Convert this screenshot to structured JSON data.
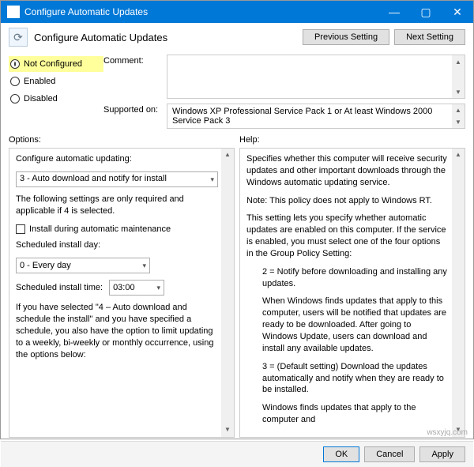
{
  "window": {
    "title": "Configure Automatic Updates"
  },
  "header": {
    "title": "Configure Automatic Updates",
    "btn_prev": "Previous Setting",
    "btn_next": "Next Setting"
  },
  "state": {
    "not_configured": "Not Configured",
    "enabled": "Enabled",
    "disabled": "Disabled",
    "selected": "not_configured"
  },
  "fields": {
    "comment_label": "Comment:",
    "comment_value": "",
    "supported_label": "Supported on:",
    "supported_value": "Windows XP Professional Service Pack 1 or At least Windows 2000 Service Pack 3"
  },
  "options": {
    "pane_label": "Options:",
    "update_label": "Configure automatic updating:",
    "update_value": "3 - Auto download and notify for install",
    "note": "The following settings are only required and applicable if 4 is selected.",
    "maint_check": "Install during automatic maintenance",
    "day_label": "Scheduled install day:",
    "day_value": "0 - Every day",
    "time_label": "Scheduled install time:",
    "time_value": "03:00",
    "tail": "If you have selected \"4 – Auto download and schedule the install\" and you have specified a schedule, you also have the option to limit updating to a weekly, bi-weekly or monthly occurrence, using the options below:"
  },
  "help": {
    "pane_label": "Help:",
    "p1": "Specifies whether this computer will receive security updates and other important downloads through the Windows automatic updating service.",
    "p2": "Note: This policy does not apply to Windows RT.",
    "p3": "This setting lets you specify whether automatic updates are enabled on this computer. If the service is enabled, you must select one of the four options in the Group Policy Setting:",
    "p4": "2 = Notify before downloading and installing any updates.",
    "p5": "When Windows finds updates that apply to this computer, users will be notified that updates are ready to be downloaded. After going to Windows Update, users can download and install any available updates.",
    "p6": "3 = (Default setting) Download the updates automatically and notify when they are ready to be installed.",
    "p7": "Windows finds updates that apply to the computer and"
  },
  "footer": {
    "ok": "OK",
    "cancel": "Cancel",
    "apply": "Apply"
  },
  "watermark": "wsxyjq.com"
}
